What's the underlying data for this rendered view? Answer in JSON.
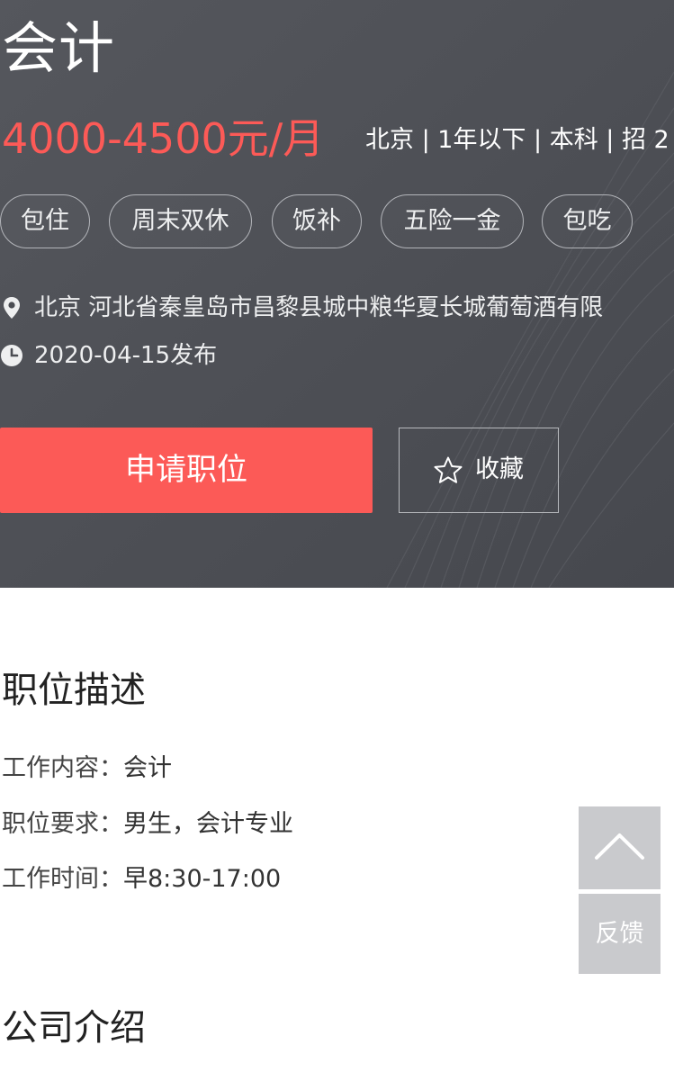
{
  "job": {
    "title": "会计",
    "salary": "4000-4500元/月",
    "meta": "北京 | 1年以下 | 本科 | 招 2",
    "tags": [
      "包住",
      "周末双休",
      "饭补",
      "五险一金",
      "包吃"
    ],
    "location": "北京 河北省秦皇岛市昌黎县城中粮华夏长城葡萄酒有限",
    "posted": "2020-04-15发布"
  },
  "actions": {
    "apply_label": "申请职位",
    "favorite_label": "收藏"
  },
  "description": {
    "title": "职位描述",
    "items": [
      {
        "label": "工作内容：",
        "value": "会计"
      },
      {
        "label": "职位要求：",
        "value": "男生，会计专业"
      },
      {
        "label": "工作时间：",
        "value": "早8:30-17:00"
      }
    ]
  },
  "company": {
    "title": "公司介绍"
  },
  "floating": {
    "feedback_label": "反馈"
  },
  "colors": {
    "header_bg": "#4b4d53",
    "accent": "#fc5a57",
    "side_button": "#c9cacd"
  }
}
